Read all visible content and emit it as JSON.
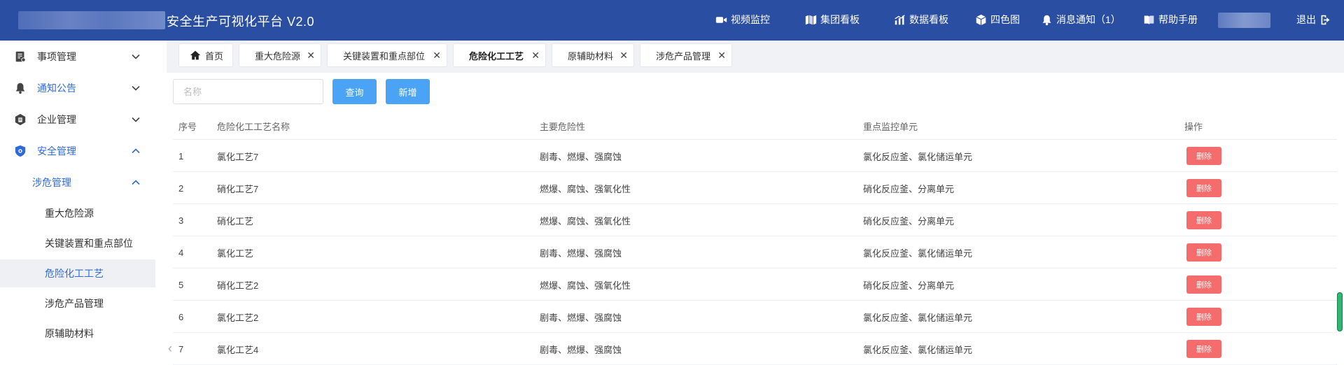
{
  "header": {
    "title": "安全生产可视化平台  V2.0",
    "nav": [
      {
        "label": "视频监控",
        "icon": "video-camera-icon"
      },
      {
        "label": "集团看板",
        "icon": "map-icon"
      },
      {
        "label": "数据看板",
        "icon": "bar-chart-icon"
      },
      {
        "label": "四色图",
        "icon": "cube-icon"
      },
      {
        "label": "消息通知（1）",
        "icon": "bell-icon"
      },
      {
        "label": "帮助手册",
        "icon": "book-icon"
      }
    ],
    "logout_label": "退出"
  },
  "sidebar": {
    "items": [
      {
        "label": "事项管理",
        "icon": "task-list-icon"
      },
      {
        "label": "通知公告",
        "icon": "bell-icon"
      },
      {
        "label": "企业管理",
        "icon": "enterprise-icon"
      },
      {
        "label": "安全管理",
        "icon": "shield-icon"
      }
    ],
    "group": {
      "label": "涉危管理"
    },
    "sub_items": [
      {
        "label": "重大危险源"
      },
      {
        "label": "关键装置和重点部位"
      },
      {
        "label": "危险化工工艺"
      },
      {
        "label": "涉危产品管理"
      },
      {
        "label": "原辅助材料"
      }
    ]
  },
  "tabs": [
    {
      "label": "首页"
    },
    {
      "label": "重大危险源"
    },
    {
      "label": "关键装置和重点部位"
    },
    {
      "label": "危险化工工艺"
    },
    {
      "label": "原辅助材料"
    },
    {
      "label": "涉危产品管理"
    }
  ],
  "search": {
    "placeholder": "名称",
    "query_label": "查询",
    "add_label": "新增"
  },
  "table": {
    "columns": [
      "序号",
      "危险化工工艺名称",
      "主要危险性",
      "重点监控单元",
      "操作"
    ],
    "rows": [
      {
        "no": "1",
        "name": "氯化工艺7",
        "hazard": "剧毒、燃爆、强腐蚀",
        "unit": "氯化反应釜、氯化储运单元",
        "action": "删除"
      },
      {
        "no": "2",
        "name": "硝化工艺7",
        "hazard": "燃爆、腐蚀、强氧化性",
        "unit": "硝化反应釜、分离单元",
        "action": "删除"
      },
      {
        "no": "3",
        "name": "硝化工艺",
        "hazard": "燃爆、腐蚀、强氧化性",
        "unit": "硝化反应釜、分离单元",
        "action": "删除"
      },
      {
        "no": "4",
        "name": "氯化工艺",
        "hazard": "剧毒、燃爆、强腐蚀",
        "unit": "氯化反应釜、氯化储运单元",
        "action": "删除"
      },
      {
        "no": "5",
        "name": "硝化工艺2",
        "hazard": "燃爆、腐蚀、强氧化性",
        "unit": "硝化反应釜、分离单元",
        "action": "删除"
      },
      {
        "no": "6",
        "name": "氯化工艺2",
        "hazard": "剧毒、燃爆、强腐蚀",
        "unit": "氯化反应釜、氯化储运单元",
        "action": "删除"
      },
      {
        "no": "7",
        "name": "氯化工艺4",
        "hazard": "剧毒、燃爆、强腐蚀",
        "unit": "氯化反应釜、氯化储运单元",
        "action": "删除"
      }
    ]
  },
  "colors": {
    "header_bg": "#2a4ea2",
    "primary": "#4aa3f5",
    "danger": "#f56c6c",
    "active_menu": "#2f6bd6"
  }
}
